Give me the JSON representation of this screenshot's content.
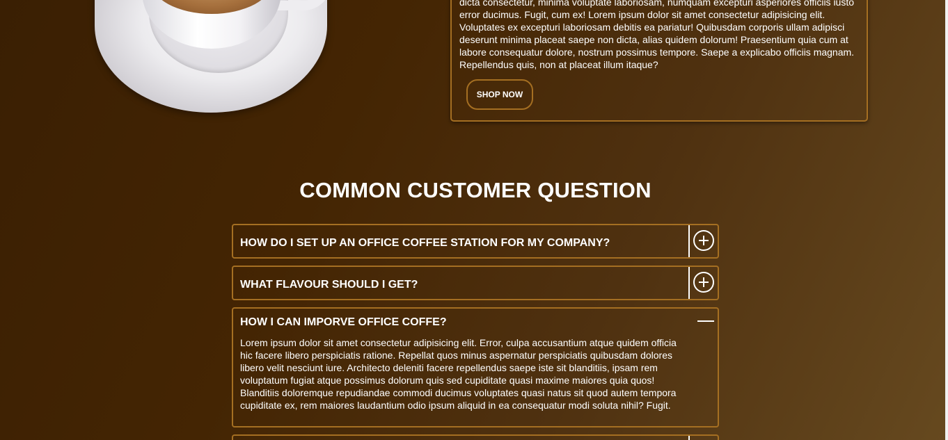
{
  "about": {
    "paragraph": "dicta consectetur, minima voluptate laboriosam, numquam excepturi asperiores officiis iusto error ducimus. Fugit, cum ex! Lorem ipsum dolor sit amet consectetur adipisicing elit. Voluptates ex excepturi laboriosam debitis ea pariatur! Quibusdam corporis ullam adipisci deserunt minima placeat saepe non dicta, alias quidem dolorum! Praesentium quia cum at labore consequatur dolore, nostrum possimus tempore. Saepe a explicabo officiis magnam. Repellendus quis, non at placeat illum itaque?",
    "shop_button": "SHOP NOW"
  },
  "faq": {
    "title": "COMMON CUSTOMER QUESTION",
    "items": [
      {
        "question": "HOW DO I SET UP AN OFFICE COFFEE STATION FOR MY COMPANY?",
        "state": "collapsed",
        "icon": "plus-circle-icon"
      },
      {
        "question": "WHAT FLAVOUR SHOULD I GET?",
        "state": "collapsed",
        "icon": "plus-circle-icon"
      },
      {
        "question": "HOW I CAN IMPORVE OFFICE COFFE?",
        "state": "open",
        "icon": "minus-icon",
        "answer": "Lorem ipsum dolor sit amet consectetur adipisicing elit. Error, culpa accusantium atque quidem officia hic facere libero perspiciatis ratione. Repellat quos minus aspernatur perspiciatis quibusdam dolores libero velit nesciunt iure. Architecto deleniti facere repellendus saepe iste sit blanditiis, ipsam rem voluptatum fugiat atque possimus dolorum quis sed cupiditate quasi maxime maiores quia quos! Blanditiis doloremque repudiandae commodi ducimus voluptates quasi natus sit quod autem tempora cupiditate ex, rem maiores laudantium odio ipsum aliquid in ea consequatur modi soluta nihil? Fugit."
      },
      {
        "question": "",
        "state": "collapsed",
        "icon": "plus-circle-icon"
      }
    ]
  },
  "colors": {
    "accent_border": "#a56f22",
    "background_dark": "#3a1f03",
    "background_light": "#66491f",
    "text": "#ffffff"
  },
  "image": {
    "icon": "coffee-cup-image"
  }
}
